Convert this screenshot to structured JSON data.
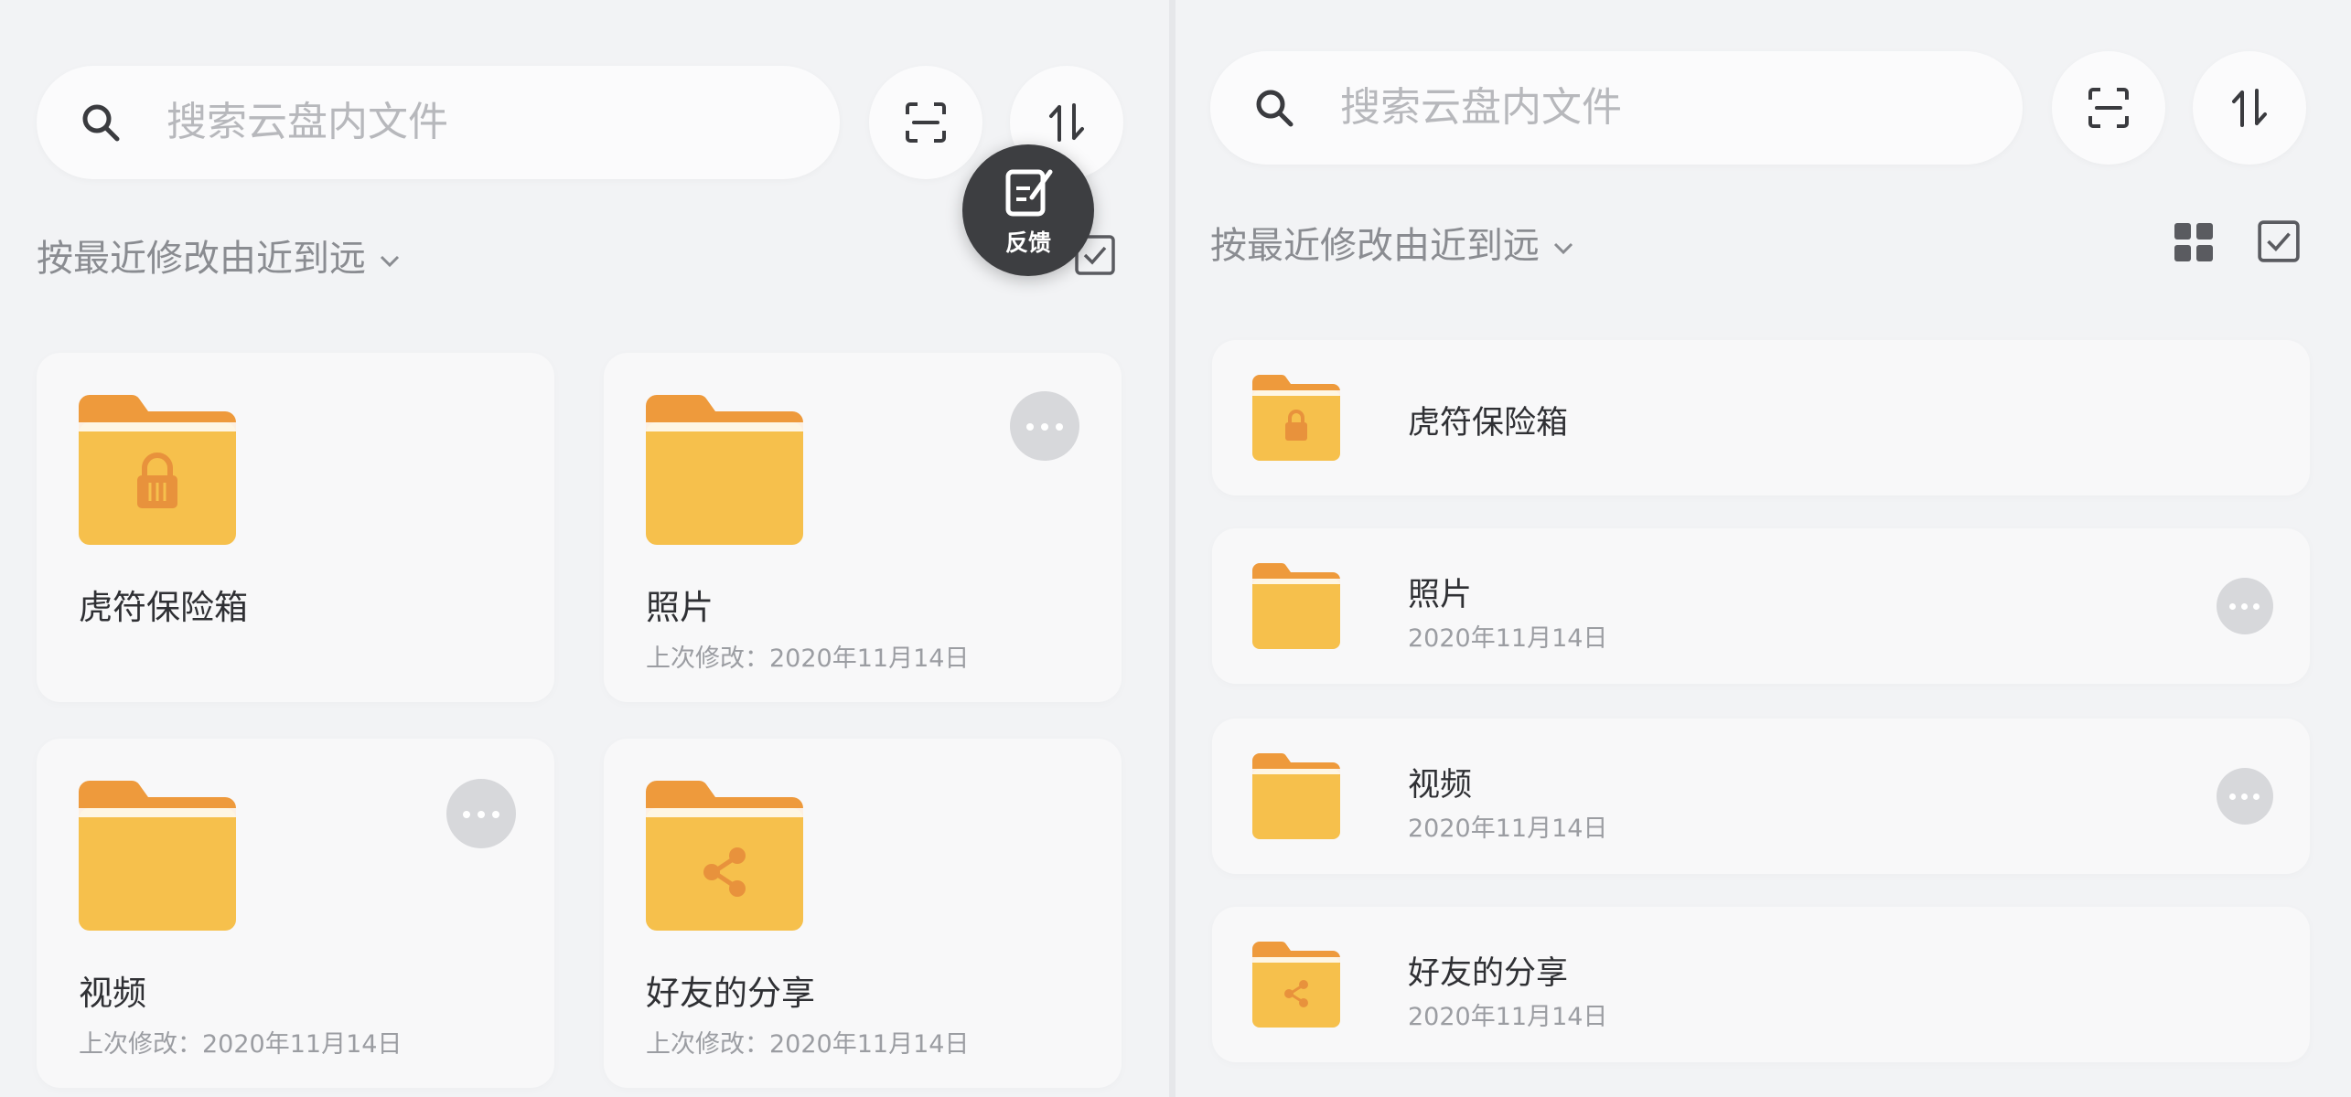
{
  "search": {
    "placeholder": "搜索云盘内文件"
  },
  "sort": {
    "label": "按最近修改由近到远"
  },
  "feedback": {
    "label": "反馈"
  },
  "grid_view": {
    "items": [
      {
        "name": "虎符保险箱",
        "meta": "",
        "icon": "lock-folder-icon"
      },
      {
        "name": "照片",
        "meta": "上次修改：2020年11月14日",
        "icon": "folder-icon"
      },
      {
        "name": "视频",
        "meta": "上次修改：2020年11月14日",
        "icon": "folder-icon"
      },
      {
        "name": "好友的分享",
        "meta": "上次修改：2020年11月14日",
        "icon": "share-folder-icon"
      }
    ]
  },
  "list_view": {
    "items": [
      {
        "name": "虎符保险箱",
        "meta": "",
        "icon": "lock-folder-icon"
      },
      {
        "name": "照片",
        "meta": "2020年11月14日",
        "icon": "folder-icon"
      },
      {
        "name": "视频",
        "meta": "2020年11月14日",
        "icon": "folder-icon"
      },
      {
        "name": "好友的分享",
        "meta": "2020年11月14日",
        "icon": "share-folder-icon"
      }
    ]
  },
  "colors": {
    "background": "#f2f3f5",
    "card": "#f8f8f9",
    "folder_back": "#ee9a3c",
    "folder_front": "#f6c04c",
    "text_primary": "#2f3034",
    "text_secondary": "#9b9da2",
    "feedback_bg": "#3d3e41"
  }
}
